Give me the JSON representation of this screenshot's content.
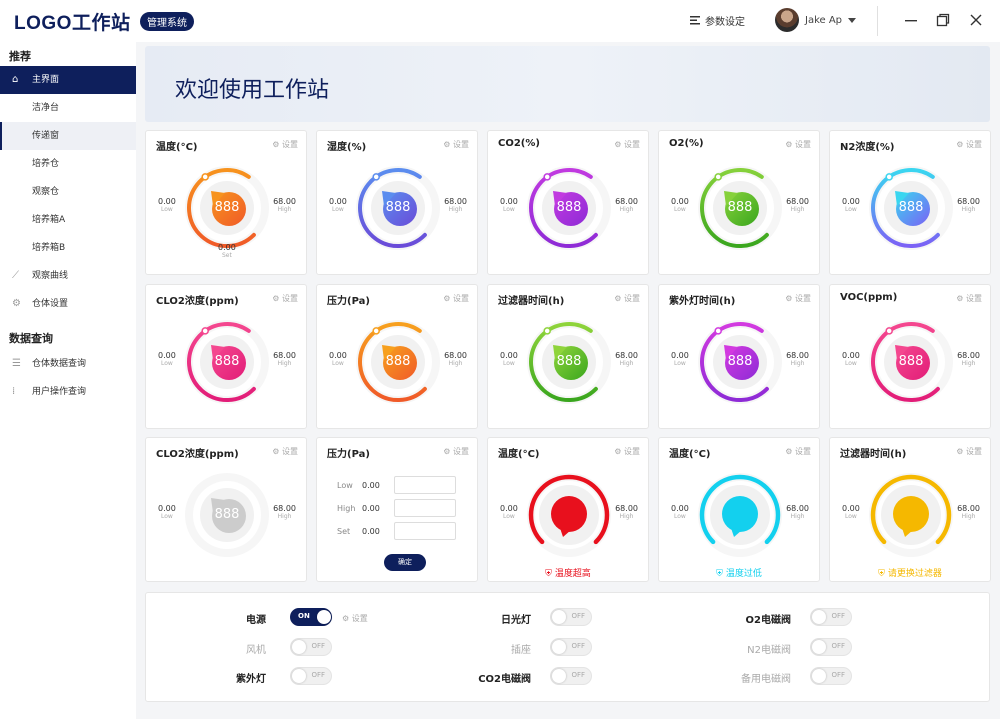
{
  "header": {
    "logo": "LOGO工作站",
    "badge": "管理系统",
    "settings_label": "参数设定",
    "user_name": "Jake Ap"
  },
  "sidebar": {
    "section1": "推荐",
    "items": [
      {
        "label": "主界面",
        "icon": "home-icon"
      },
      {
        "label": "洁净台"
      },
      {
        "label": "传递窗"
      },
      {
        "label": "培养仓"
      },
      {
        "label": "观察仓"
      },
      {
        "label": "培养箱A"
      },
      {
        "label": "培养箱B"
      },
      {
        "label": "观察曲线",
        "icon": "chart-icon"
      },
      {
        "label": "仓体设置",
        "icon": "gear-icon"
      }
    ],
    "section2": "数据查询",
    "items2": [
      {
        "label": "仓体数据查询",
        "icon": "list-icon"
      },
      {
        "label": "用户操作查询",
        "icon": "grid-icon"
      }
    ]
  },
  "banner": {
    "title": "欢迎使用工作站"
  },
  "common": {
    "set_label": "设置",
    "low": "Low",
    "high": "High",
    "set": "Set",
    "value": "888",
    "low_val": "0.00",
    "high_val": "68.00"
  },
  "cards": [
    {
      "title": "温度(°C)",
      "color1": "#f7931e",
      "color2": "#f05a28",
      "set_val": "0.00"
    },
    {
      "title": "湿度(%)",
      "color1": "#5b8def",
      "color2": "#6a4bd8"
    },
    {
      "title": "CO2(%)",
      "color1": "#c13ae0",
      "color2": "#8e2bd6"
    },
    {
      "title": "O2(%)",
      "color1": "#86d13b",
      "color2": "#3aa61e"
    },
    {
      "title": "N2浓度(%)",
      "color1": "#3ad6f0",
      "color2": "#7b61f5"
    },
    {
      "title": "CLO2浓度(ppm)",
      "color1": "#f4478f",
      "color2": "#e21d78"
    },
    {
      "title": "压力(Pa)",
      "color1": "#f7a01e",
      "color2": "#f05a28"
    },
    {
      "title": "过滤器时间(h)",
      "color1": "#8fd43b",
      "color2": "#3aa61e"
    },
    {
      "title": "紫外灯时间(h)",
      "color1": "#d23ae0",
      "color2": "#8e2bd6"
    },
    {
      "title": "VOC(ppm)",
      "color1": "#f4478f",
      "color2": "#e21d78"
    },
    {
      "title": "CLO2浓度(ppm)",
      "color1": "#cccccc",
      "color2": "#cccccc"
    },
    {
      "title": "压力(Pa)"
    },
    {
      "title": "温度(°C)",
      "color1": "#e8101d",
      "alert": "温度超高"
    },
    {
      "title": "温度(°C)",
      "color1": "#13d0ee",
      "alert": "温度过低"
    },
    {
      "title": "过滤器时间(h)",
      "color1": "#f5b800",
      "alert": "请更换过滤器"
    }
  ],
  "input_card": {
    "rows": [
      {
        "label": "Low",
        "value": "0.00"
      },
      {
        "label": "High",
        "value": "0.00"
      },
      {
        "label": "Set",
        "value": "0.00"
      }
    ],
    "button": "确定"
  },
  "switches": [
    {
      "label": "电源",
      "state": "ON",
      "on": true,
      "enabled": true
    },
    {
      "label": "日光灯",
      "state": "OFF",
      "on": false,
      "enabled": true
    },
    {
      "label": "O2电磁阀",
      "state": "OFF",
      "on": false,
      "enabled": true
    },
    {
      "label": "风机",
      "state": "OFF",
      "on": false,
      "enabled": false
    },
    {
      "label": "插座",
      "state": "OFF",
      "on": false,
      "enabled": false
    },
    {
      "label": "N2电磁阀",
      "state": "OFF",
      "on": false,
      "enabled": false
    },
    {
      "label": "紫外灯",
      "state": "OFF",
      "on": false,
      "enabled": true
    },
    {
      "label": "CO2电磁阀",
      "state": "OFF",
      "on": false,
      "enabled": true
    },
    {
      "label": "备用电磁阀",
      "state": "OFF",
      "on": false,
      "enabled": false
    }
  ]
}
